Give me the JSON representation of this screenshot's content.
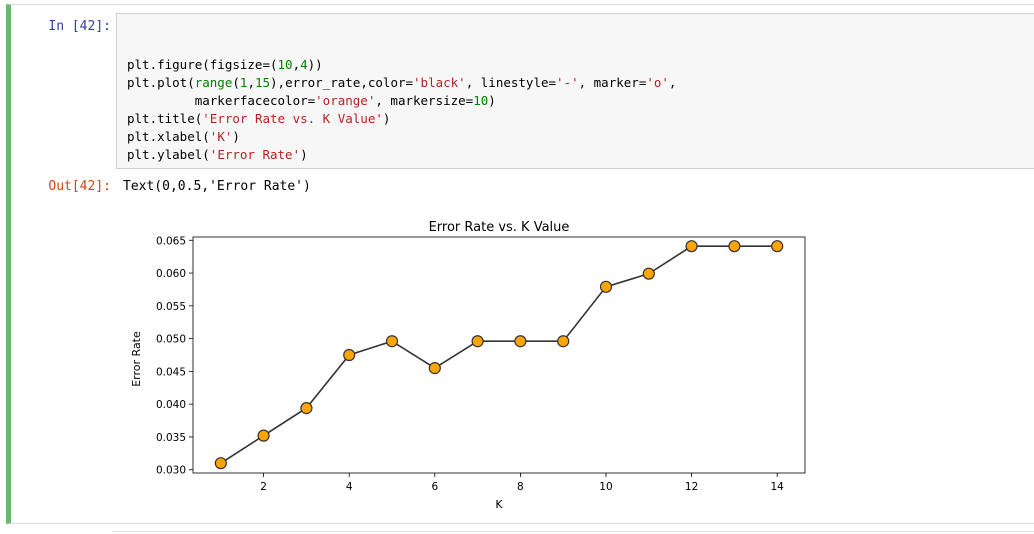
{
  "input_prompt": "In [42]:",
  "output_prompt": "Out[42]:",
  "code_lines": [
    [
      {
        "t": "plt.figure(figsize=("
      },
      {
        "t": "10",
        "c": "num"
      },
      {
        "t": ","
      },
      {
        "t": "4",
        "c": "num"
      },
      {
        "t": "))"
      }
    ],
    [
      {
        "t": "plt.plot("
      },
      {
        "t": "range",
        "c": "bi"
      },
      {
        "t": "("
      },
      {
        "t": "1",
        "c": "num"
      },
      {
        "t": ","
      },
      {
        "t": "15",
        "c": "num"
      },
      {
        "t": "),error_rate,color="
      },
      {
        "t": "'black'",
        "c": "str"
      },
      {
        "t": ", linestyle="
      },
      {
        "t": "'-'",
        "c": "str"
      },
      {
        "t": ", marker="
      },
      {
        "t": "'o'",
        "c": "str"
      },
      {
        "t": ","
      }
    ],
    [
      {
        "t": "         markerfacecolor="
      },
      {
        "t": "'orange'",
        "c": "str"
      },
      {
        "t": ", markersize="
      },
      {
        "t": "10",
        "c": "num"
      },
      {
        "t": ")"
      }
    ],
    [
      {
        "t": "plt.title("
      },
      {
        "t": "'Error Rate vs. K Value'",
        "c": "str"
      },
      {
        "t": ")"
      }
    ],
    [
      {
        "t": "plt.xlabel("
      },
      {
        "t": "'K'",
        "c": "str"
      },
      {
        "t": ")"
      }
    ],
    [
      {
        "t": "plt.ylabel("
      },
      {
        "t": "'Error Rate'",
        "c": "str"
      },
      {
        "t": ")"
      }
    ]
  ],
  "output_text": "Text(0,0.5,'Error Rate')",
  "colors": {
    "cell_border": "#66bb6a",
    "line": "#333333",
    "marker_fill": "#ffa500",
    "marker_edge": "#333333"
  },
  "chart_data": {
    "type": "line",
    "title": "Error Rate vs. K Value",
    "xlabel": "K",
    "ylabel": "Error Rate",
    "x": [
      1,
      2,
      3,
      4,
      5,
      6,
      7,
      8,
      9,
      10,
      11,
      12,
      13,
      14
    ],
    "y": [
      0.031,
      0.0352,
      0.0394,
      0.0475,
      0.0496,
      0.0455,
      0.0496,
      0.0496,
      0.0496,
      0.0579,
      0.0599,
      0.0641,
      0.0641,
      0.0641
    ],
    "xlim": [
      0.35,
      14.65
    ],
    "ylim": [
      0.0295,
      0.0655
    ],
    "xticks": [
      2,
      4,
      6,
      8,
      10,
      12,
      14
    ],
    "xtick_labels": [
      "2",
      "4",
      "6",
      "8",
      "10",
      "12",
      "14"
    ],
    "yticks": [
      0.03,
      0.035,
      0.04,
      0.045,
      0.05,
      0.055,
      0.06,
      0.065
    ],
    "ytick_labels": [
      "0.030",
      "0.035",
      "0.040",
      "0.045",
      "0.050",
      "0.055",
      "0.060",
      "0.065"
    ],
    "grid": false,
    "legend": "none"
  }
}
